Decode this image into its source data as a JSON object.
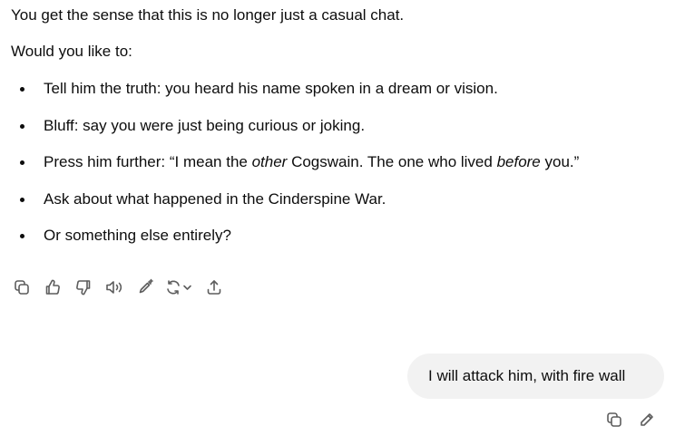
{
  "assistant_message": {
    "paragraphs": [
      "You get the sense that this is no longer just a casual chat.",
      "Would you like to:"
    ],
    "options": [
      {
        "text": "Tell him the truth: you heard his name spoken in a dream or vision."
      },
      {
        "text": "Bluff: say you were just being curious or joking."
      },
      {
        "part1": "Press him further: “I mean the ",
        "emph1": "other",
        "part2": " Cogswain. The one who lived ",
        "emph2": "before",
        "part3": " you.”"
      },
      {
        "text": "Ask about what happened in the Cinderspine War."
      },
      {
        "text": "Or something else entirely?"
      }
    ]
  },
  "assistant_actions": [
    {
      "icon": "copy-icon"
    },
    {
      "icon": "thumbs-up-icon"
    },
    {
      "icon": "thumbs-down-icon"
    },
    {
      "icon": "read-aloud-icon"
    },
    {
      "icon": "edit-in-canvas-icon"
    },
    {
      "icon": "regenerate-icon"
    },
    {
      "icon": "share-icon"
    }
  ],
  "user_message": {
    "text": "I will attack him, with fire wall"
  },
  "user_actions": [
    {
      "icon": "copy-icon"
    },
    {
      "icon": "edit-icon"
    }
  ],
  "colors": {
    "text": "#0d0d0d",
    "icon": "#5d5d5d",
    "user_bubble_bg": "#f2f2f2"
  }
}
